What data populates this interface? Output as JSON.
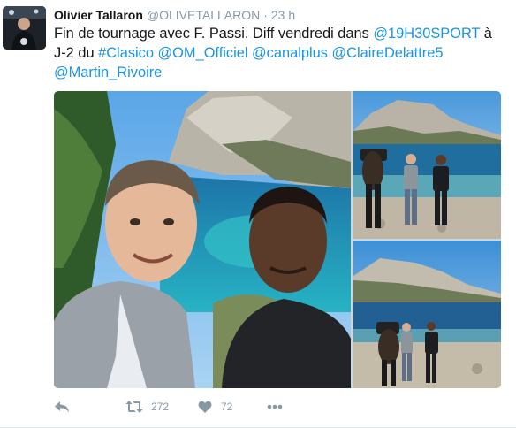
{
  "tweet": {
    "author": {
      "name": "Olivier Tallaron",
      "handle": "@OLIVETALLARON",
      "separator": "·",
      "time": "23 h"
    },
    "text": {
      "t1": "Fin de tournage avec F. Passi. Diff vendredi dans ",
      "m1": "@19H30SPORT",
      "t2": " à J-2 du ",
      "h1": "#Clasico",
      "t3": " ",
      "m2": "@OM_Officiel",
      "t4": " ",
      "m3": "@canalplus",
      "t5": " ",
      "m4": "@ClaireDelattre5",
      "t6": " ",
      "m5": "@Martin_Rivoire"
    },
    "link_color": "#1b95e0",
    "photos": [
      "selfie-photo",
      "interview-photo-1",
      "interview-photo-2"
    ],
    "actions": {
      "reply_icon": "reply-icon",
      "retweet_icon": "retweet-icon",
      "retweet_count": "272",
      "like_icon": "heart-icon",
      "like_count": "72",
      "more_icon": "more-icon"
    }
  }
}
